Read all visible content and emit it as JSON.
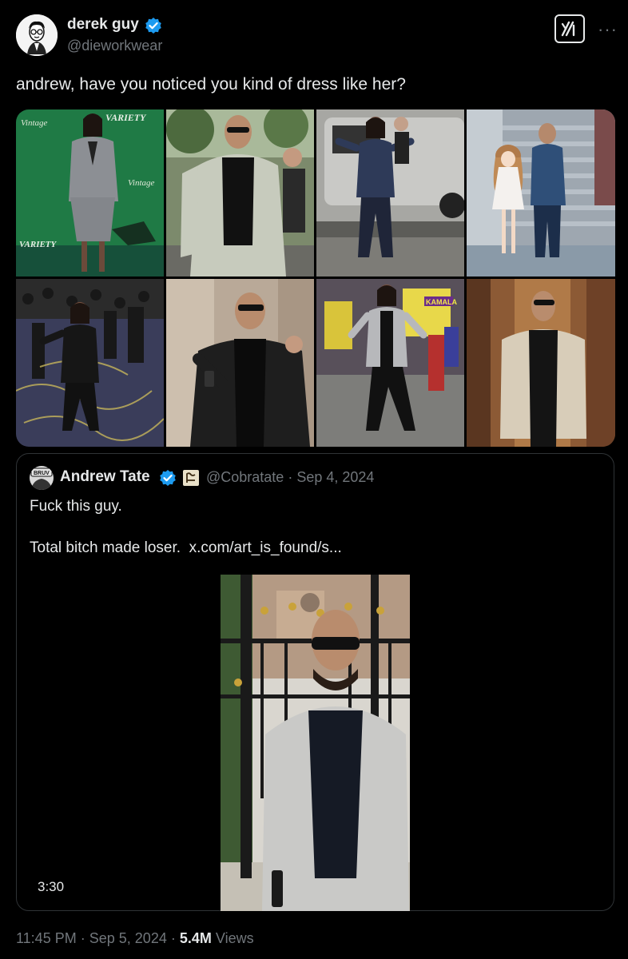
{
  "tweet": {
    "author_name": "derek guy",
    "author_handle": "@dieworkwear",
    "text": "andrew, have you noticed you kind of dress like her?",
    "time": "11:45 PM",
    "date": "Sep 5, 2024",
    "views_count": "5.4M",
    "views_label": "Views",
    "separator": "·"
  },
  "grid_labels": {
    "vintage": "Vintage",
    "variety": "VARIETY",
    "kamala_sign": "KAMALA"
  },
  "quote": {
    "author_name": "Andrew Tate",
    "avatar_text": "BRUV",
    "handle": "@Cobratate",
    "date": "Sep 4, 2024",
    "line1": "Fuck this guy.",
    "line2": "Total bitch made loser.",
    "link": "x.com/art_is_found/s...",
    "video_duration": "3:30"
  },
  "colors": {
    "background": "#000000",
    "text": "#e7e9ea",
    "muted": "#71767b",
    "verified": "#1d9bf0",
    "border": "#2f3336"
  },
  "icons": [
    "verified-badge-icon",
    "grok-icon",
    "more-icon",
    "flag-icon"
  ]
}
